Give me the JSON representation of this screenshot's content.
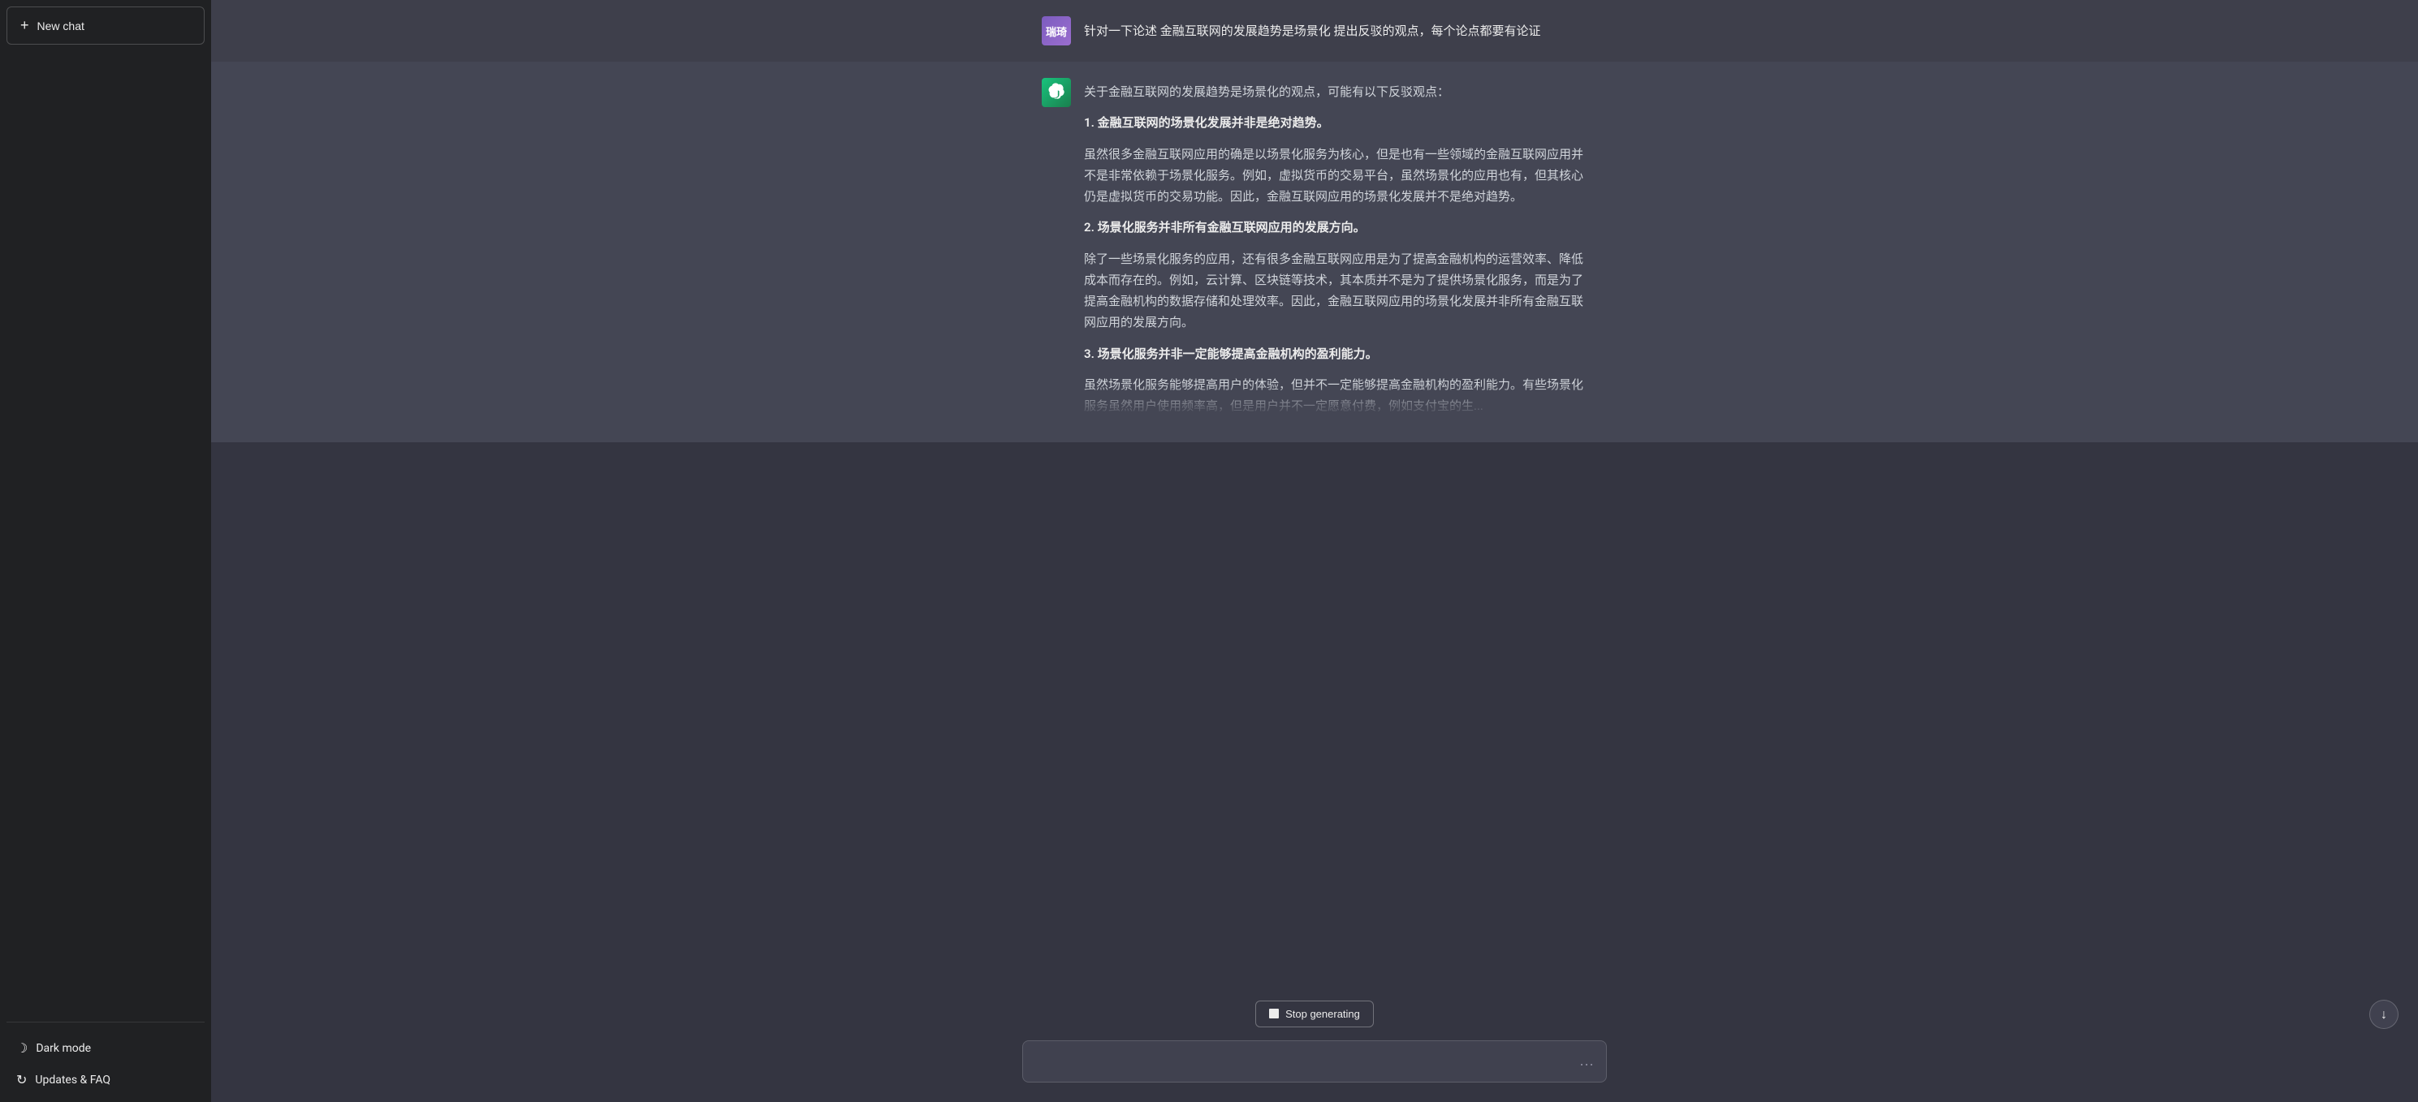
{
  "sidebar": {
    "new_chat_label": "New chat",
    "plus_icon": "+",
    "bottom_items": [
      {
        "id": "dark-mode",
        "label": "Dark mode",
        "icon": "moon"
      },
      {
        "id": "updates-faq",
        "label": "Updates & FAQ",
        "icon": "info"
      }
    ]
  },
  "chat": {
    "user_avatar_text": "瑞琦",
    "user_message": "针对一下论述 金融互联网的发展趋势是场景化 提出反驳的观点，每个论点都要有论证",
    "ai_intro": "关于金融互联网的发展趋势是场景化的观点，可能有以下反驳观点：",
    "points": [
      {
        "number": "1.",
        "header": "金融互联网的场景化发展并非是绝对趋势。",
        "body": "虽然很多金融互联网应用的确是以场景化服务为核心，但是也有一些领域的金融互联网应用并不是非常依赖于场景化服务。例如，虚拟货币的交易平台，虽然场景化的应用也有，但其核心仍是虚拟货币的交易功能。因此，金融互联网应用的场景化发展并不是绝对趋势。"
      },
      {
        "number": "2.",
        "header": "场景化服务并非所有金融互联网应用的发展方向。",
        "body": "除了一些场景化服务的应用，还有很多金融互联网应用是为了提高金融机构的运营效率、降低成本而存在的。例如，云计算、区块链等技术，其本质并不是为了提供场景化服务，而是为了提高金融机构的数据存储和处理效率。因此，金融互联网应用的场景化发展并非所有金融互联网应用的发展方向。"
      },
      {
        "number": "3.",
        "header": "场景化服务并非一定能够提高金融机构的盈利能力。",
        "body_partial": "虽然场景化服务能够提高用户的体验，但并不一定能够提高金融机构的盈利能力。有些场景化服务虽然用户使用频率高，但是用户并不一定愿意付费，例如支付宝的生..."
      }
    ]
  },
  "input": {
    "placeholder": "",
    "current_value": "",
    "more_options_icon": "···"
  },
  "stop_generating": {
    "label": "Stop generating"
  },
  "scroll_down": {
    "icon": "↓"
  }
}
